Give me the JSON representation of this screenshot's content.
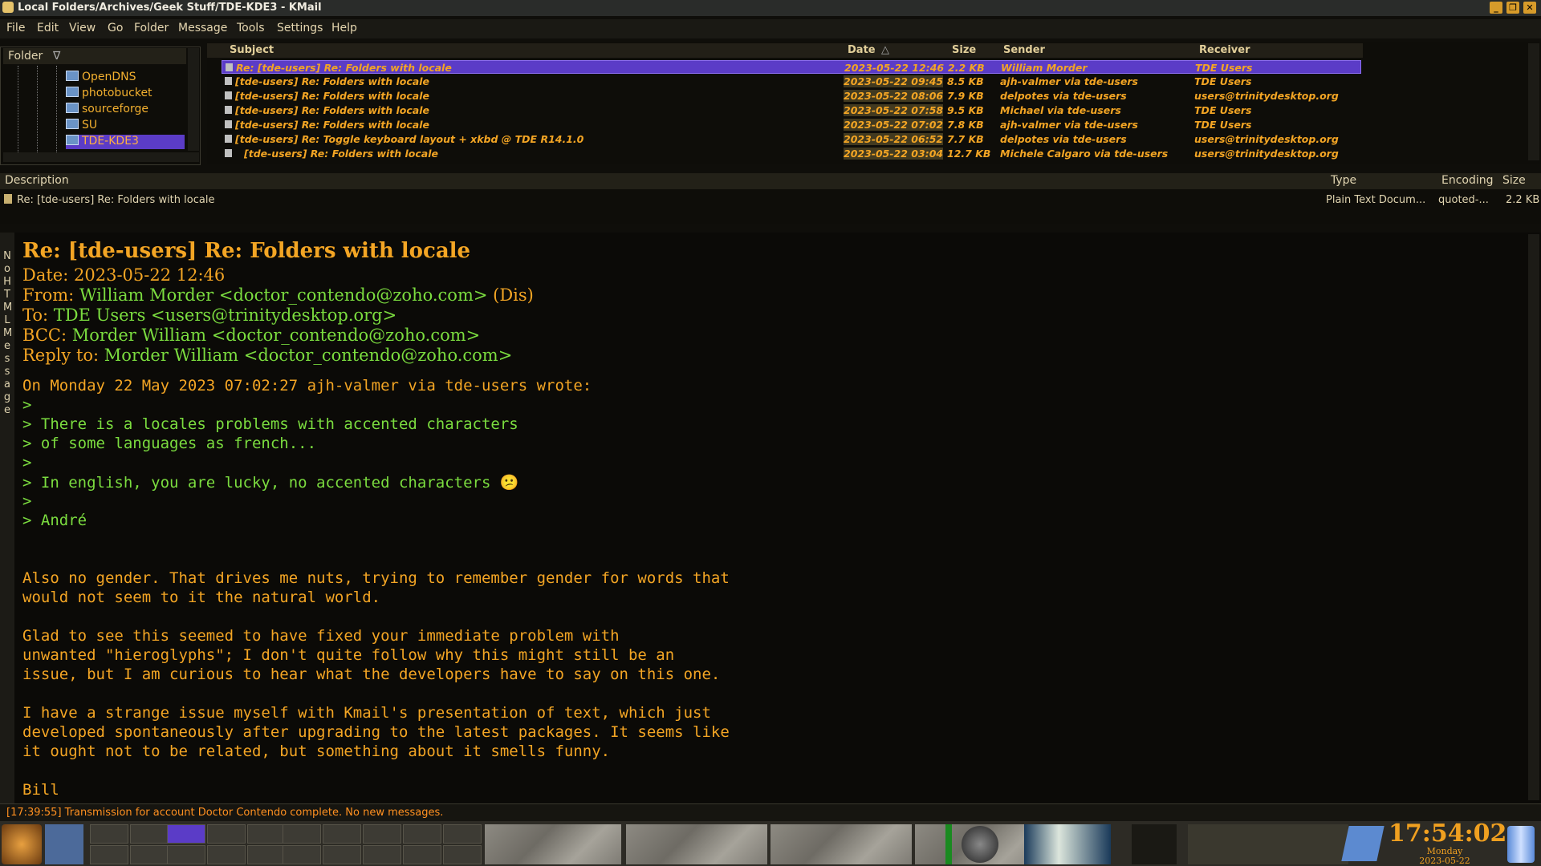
{
  "window": {
    "title": "Local Folders/Archives/Geek Stuff/TDE-KDE3 - KMail"
  },
  "menu": [
    "File",
    "Edit",
    "View",
    "Go",
    "Folder",
    "Message",
    "Tools",
    "Settings",
    "Help"
  ],
  "folders": {
    "header": "Folder",
    "sort_indicator": "∇",
    "items": [
      {
        "label": "OpenDNS"
      },
      {
        "label": "photobucket"
      },
      {
        "label": "sourceforge"
      },
      {
        "label": "SU"
      },
      {
        "label": "TDE-KDE3",
        "selected": true
      }
    ]
  },
  "message_list": {
    "columns": {
      "subject": "Subject",
      "date": "Date",
      "size": "Size",
      "sender": "Sender",
      "receiver": "Receiver"
    },
    "rows": [
      {
        "subject": "Re: [tde-users] Re: Folders with locale",
        "date": "2023-05-22 12:46",
        "size": "2.2 KB",
        "sender": "William Morder",
        "receiver": "TDE Users",
        "selected": true
      },
      {
        "subject": "[tde-users] Re: Folders with locale",
        "date": "2023-05-22 09:45",
        "size": "8.5 KB",
        "sender": "ajh-valmer via tde-users",
        "receiver": "TDE Users"
      },
      {
        "subject": "[tde-users] Re: Folders with locale",
        "date": "2023-05-22 08:06",
        "size": "7.9 KB",
        "sender": "delpotes via tde-users",
        "receiver": "users@trinitydesktop.org"
      },
      {
        "subject": "[tde-users] Re: Folders with locale",
        "date": "2023-05-22 07:58",
        "size": "9.5 KB",
        "sender": "Michael via tde-users",
        "receiver": "TDE Users"
      },
      {
        "subject": "[tde-users] Re: Folders with locale",
        "date": "2023-05-22 07:02",
        "size": "7.8 KB",
        "sender": "ajh-valmer via tde-users",
        "receiver": "TDE Users"
      },
      {
        "subject": "[tde-users] Re: Toggle keyboard layout + xkbd @ TDE R14.1.0",
        "date": "2023-05-22 06:52",
        "size": "7.7 KB",
        "sender": "delpotes via tde-users",
        "receiver": "users@trinitydesktop.org"
      },
      {
        "subject": "[tde-users] Re: Folders with locale",
        "date": "2023-05-22 03:04",
        "size": "12.7 KB",
        "sender": "Michele Calgaro via tde-users",
        "receiver": "users@trinitydesktop.org"
      }
    ]
  },
  "attachments": {
    "columns": {
      "description": "Description",
      "type": "Type",
      "encoding": "Encoding",
      "size": "Size"
    },
    "row": {
      "description": "Re: [tde-users] Re: Folders with locale",
      "type": "Plain Text Docum...",
      "encoding": "quoted-...",
      "size": "2.2 KB"
    }
  },
  "reader": {
    "side_label": "No HTML Message",
    "subject": "Re: [tde-users] Re: Folders with locale",
    "date_label": "Date:",
    "date": "2023-05-22 12:46",
    "from_label": "From:",
    "from": "William Morder <doctor_contendo@zoho.com>",
    "from_extra": "(Dis)",
    "to_label": "To:",
    "to": "TDE Users <users@trinitydesktop.org>",
    "bcc_label": "BCC:",
    "bcc": "Morder William <doctor_contendo@zoho.com>",
    "replyto_label": "Reply to:",
    "replyto": "Morder William <doctor_contendo@zoho.com>",
    "lines": [
      {
        "text": "On Monday 22 May 2023 07:02:27 ajh-valmer via tde-users wrote:",
        "quote": false
      },
      {
        "text": ">",
        "quote": true
      },
      {
        "text": "> There is a locales problems with accented characters",
        "quote": true
      },
      {
        "text": "> of some languages as french...",
        "quote": true
      },
      {
        "text": ">",
        "quote": true
      },
      {
        "text": "> In english, you are lucky, no accented characters 😕",
        "quote": true
      },
      {
        "text": ">",
        "quote": true
      },
      {
        "text": "> André",
        "quote": true
      },
      {
        "text": "",
        "quote": false
      },
      {
        "text": "",
        "quote": false
      },
      {
        "text": "Also no gender. That drives me nuts, trying to remember gender for words that",
        "quote": false
      },
      {
        "text": "would not seem to it the natural world.",
        "quote": false
      },
      {
        "text": "",
        "quote": false
      },
      {
        "text": "Glad to see this seemed to have fixed your immediate problem with",
        "quote": false
      },
      {
        "text": "unwanted \"hieroglyphs\"; I don't quite follow why this might still be an",
        "quote": false
      },
      {
        "text": "issue, but I am curious to hear what the developers have to say on this one.",
        "quote": false
      },
      {
        "text": "",
        "quote": false
      },
      {
        "text": "I have a strange issue myself with Kmail's presentation of text, which just",
        "quote": false
      },
      {
        "text": "developed spontaneously after upgrading to the latest packages. It seems like",
        "quote": false
      },
      {
        "text": "it ought not to be related, but something about it smells funny.",
        "quote": false
      },
      {
        "text": "",
        "quote": false
      },
      {
        "text": "Bill",
        "quote": false
      }
    ]
  },
  "status": "[17:39:55] Transmission for account Doctor Contendo complete. No new messages.",
  "clock": {
    "time": "17:54:02",
    "day": "Monday",
    "date": "2023-05-22"
  },
  "colors": {
    "accent": "#f3a524",
    "quote": "#7bdc3f",
    "selection": "#5b3cc7"
  }
}
